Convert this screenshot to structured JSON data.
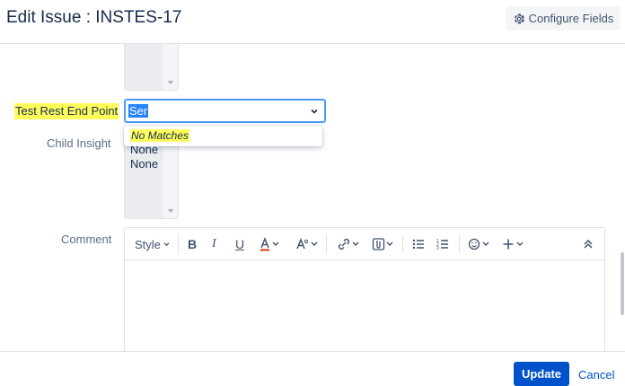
{
  "header": {
    "title": "Edit Issue : INSTES-17",
    "configure_fields_label": "Configure Fields",
    "configure_fields_icon": "gear-icon"
  },
  "form": {
    "test_rest_end_point": {
      "label": "Test Rest End Point",
      "value": "Ser",
      "dropdown_message": "No Matches"
    },
    "child_insight": {
      "label": "Child Insight",
      "options": [
        "None",
        "None"
      ]
    },
    "comment": {
      "label": "Comment",
      "toolbar": {
        "style_label": "Style",
        "items": [
          "bold-icon",
          "italic-icon",
          "underline-icon",
          "text-color-icon",
          "text-format-icon",
          "link-icon",
          "attachment-icon",
          "bullet-list-icon",
          "numbered-list-icon",
          "emoji-icon",
          "insert-more-icon",
          "collapse-icon"
        ]
      }
    }
  },
  "footer": {
    "update_label": "Update",
    "cancel_label": "Cancel"
  },
  "colors": {
    "primary": "#0052cc",
    "highlight": "#ffff5c",
    "selection": "#2684ff",
    "focus_border": "#4c9aff"
  }
}
